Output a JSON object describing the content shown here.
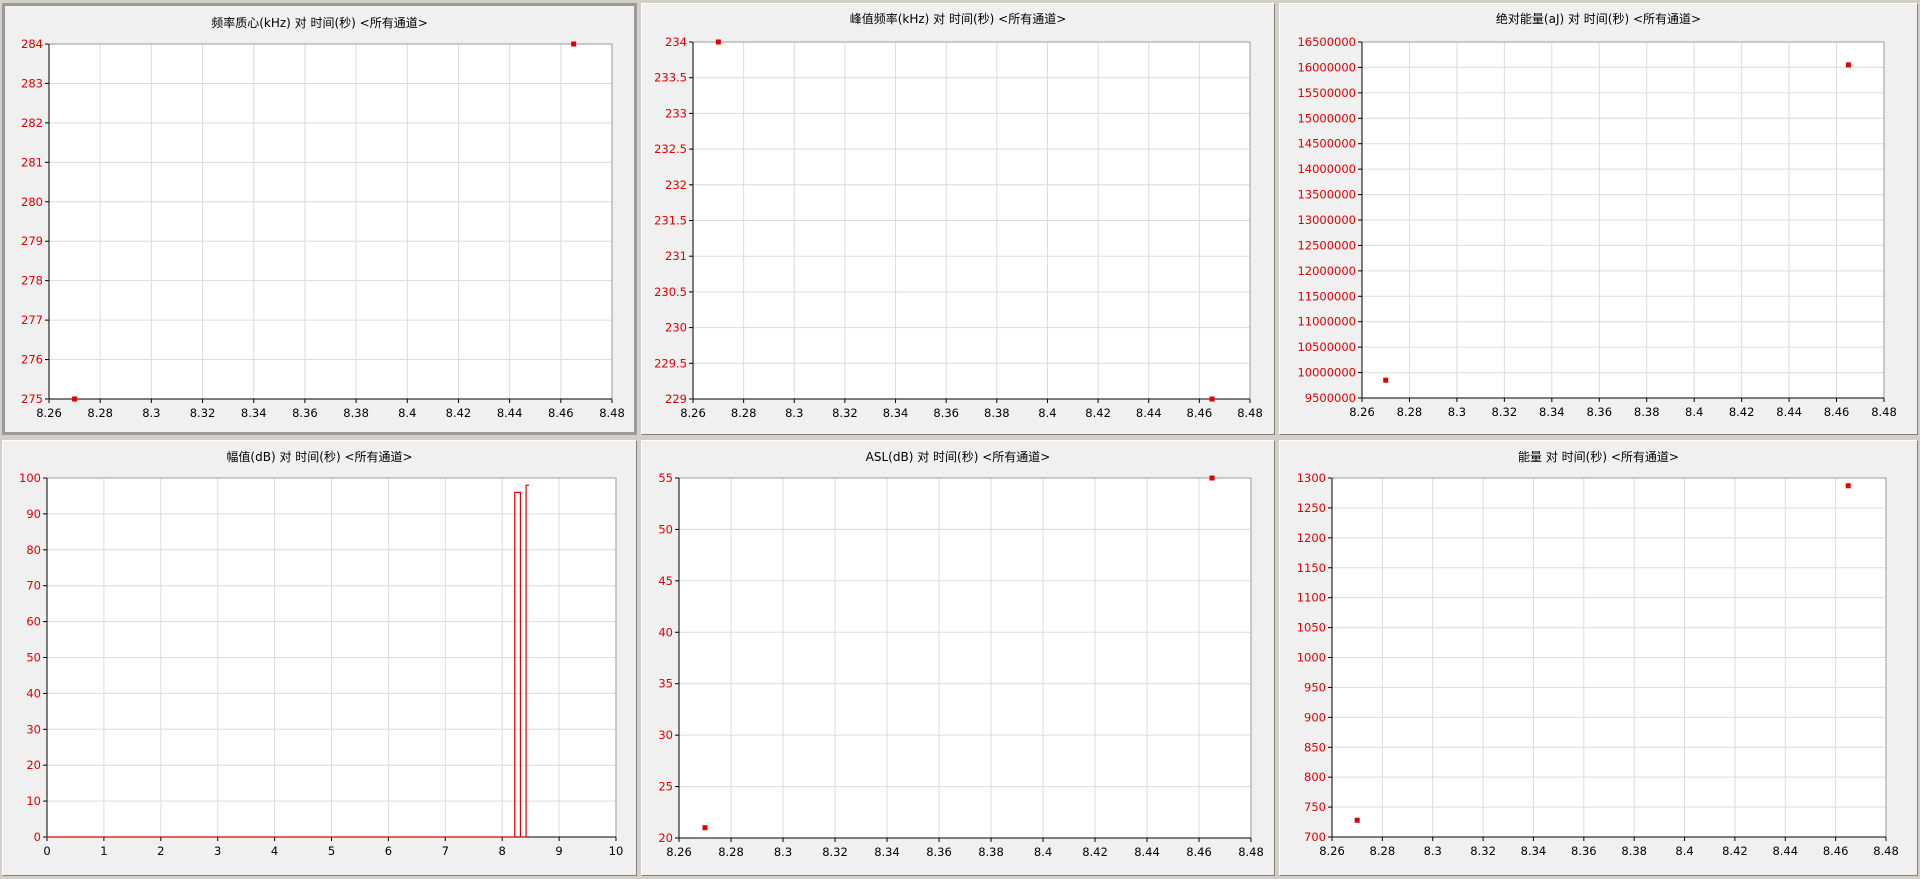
{
  "colors": {
    "series": "#e00000",
    "grid": "#dcdcdc",
    "axis": "#000000",
    "panel_bg": "#f0f0f0",
    "plot_bg": "#ffffff"
  },
  "chart_data": [
    {
      "type": "scatter",
      "title": "频率质心(kHz) 对 时间(秒) <所有通道>",
      "xlabel": "",
      "ylabel": "",
      "xlim": [
        8.26,
        8.48
      ],
      "ylim": [
        275,
        284
      ],
      "x_ticks": [
        "8.26",
        "8.28",
        "8.3",
        "8.32",
        "8.34",
        "8.36",
        "8.38",
        "8.4",
        "8.42",
        "8.44",
        "8.46",
        "8.48"
      ],
      "y_ticks": [
        "275",
        "276",
        "277",
        "278",
        "279",
        "280",
        "281",
        "282",
        "283",
        "284"
      ],
      "grid": true,
      "series": [
        {
          "x": [
            8.27,
            8.465
          ],
          "y": [
            275,
            284
          ]
        }
      ]
    },
    {
      "type": "scatter",
      "title": "峰值频率(kHz) 对 时间(秒) <所有通道>",
      "xlabel": "",
      "ylabel": "",
      "xlim": [
        8.26,
        8.48
      ],
      "ylim": [
        229,
        234
      ],
      "x_ticks": [
        "8.26",
        "8.28",
        "8.3",
        "8.32",
        "8.34",
        "8.36",
        "8.38",
        "8.4",
        "8.42",
        "8.44",
        "8.46",
        "8.48"
      ],
      "y_ticks": [
        "229",
        "229.5",
        "230",
        "230.5",
        "231",
        "231.5",
        "232",
        "232.5",
        "233",
        "233.5",
        "234"
      ],
      "grid": true,
      "series": [
        {
          "x": [
            8.27,
            8.465
          ],
          "y": [
            234,
            229
          ]
        }
      ]
    },
    {
      "type": "scatter",
      "title": "绝对能量(aJ) 对 时间(秒) <所有通道>",
      "xlabel": "",
      "ylabel": "",
      "xlim": [
        8.26,
        8.48
      ],
      "ylim": [
        9500000,
        16500000
      ],
      "x_ticks": [
        "8.26",
        "8.28",
        "8.3",
        "8.32",
        "8.34",
        "8.36",
        "8.38",
        "8.4",
        "8.42",
        "8.44",
        "8.46",
        "8.48"
      ],
      "y_ticks": [
        "9500000",
        "10000000",
        "10500000",
        "11000000",
        "11500000",
        "12000000",
        "12500000",
        "13000000",
        "13500000",
        "14000000",
        "14500000",
        "15000000",
        "15500000",
        "16000000",
        "16500000"
      ],
      "grid": true,
      "series": [
        {
          "x": [
            8.27,
            8.465
          ],
          "y": [
            9850000,
            16050000
          ]
        }
      ]
    },
    {
      "type": "line",
      "title": "幅值(dB) 对 时间(秒) <所有通道>",
      "xlabel": "",
      "ylabel": "",
      "xlim": [
        0,
        10
      ],
      "ylim": [
        0,
        100
      ],
      "x_ticks": [
        "0",
        "1",
        "2",
        "3",
        "4",
        "5",
        "6",
        "7",
        "8",
        "9",
        "10"
      ],
      "y_ticks": [
        "0",
        "10",
        "20",
        "30",
        "40",
        "50",
        "60",
        "70",
        "80",
        "90",
        "100"
      ],
      "grid": true,
      "series": [
        {
          "x": [
            0,
            8.22,
            8.22,
            8.32,
            8.32,
            8.42,
            8.42,
            8.47
          ],
          "y": [
            0,
            0,
            96,
            96,
            0,
            0,
            98,
            98
          ]
        }
      ]
    },
    {
      "type": "scatter",
      "title": "ASL(dB) 对 时间(秒) <所有通道>",
      "xlabel": "",
      "ylabel": "",
      "xlim": [
        8.26,
        8.48
      ],
      "ylim": [
        20,
        55
      ],
      "x_ticks": [
        "8.26",
        "8.28",
        "8.3",
        "8.32",
        "8.34",
        "8.36",
        "8.38",
        "8.4",
        "8.42",
        "8.44",
        "8.46",
        "8.48"
      ],
      "y_ticks": [
        "20",
        "25",
        "30",
        "35",
        "40",
        "45",
        "50",
        "55"
      ],
      "grid": true,
      "series": [
        {
          "x": [
            8.27,
            8.465
          ],
          "y": [
            21,
            55
          ]
        }
      ]
    },
    {
      "type": "scatter",
      "title": "能量 对 时间(秒) <所有通道>",
      "xlabel": "",
      "ylabel": "",
      "xlim": [
        8.26,
        8.48
      ],
      "ylim": [
        700,
        1300
      ],
      "x_ticks": [
        "8.26",
        "8.28",
        "8.3",
        "8.32",
        "8.34",
        "8.36",
        "8.38",
        "8.4",
        "8.42",
        "8.44",
        "8.46",
        "8.48"
      ],
      "y_ticks": [
        "700",
        "750",
        "800",
        "850",
        "900",
        "950",
        "1000",
        "1050",
        "1100",
        "1150",
        "1200",
        "1250",
        "1300"
      ],
      "grid": true,
      "series": [
        {
          "x": [
            8.27,
            8.465
          ],
          "y": [
            728,
            1287
          ]
        }
      ]
    }
  ]
}
